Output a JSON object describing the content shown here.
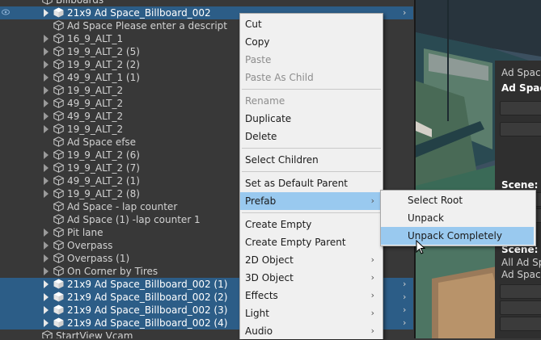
{
  "hierarchy": {
    "rows": [
      {
        "label": "Billboards",
        "kind": "folder",
        "depth": 0,
        "sel": false,
        "partial": true
      },
      {
        "label": "21x9 Ad Space_Billboard_002",
        "kind": "prefab",
        "depth": 1,
        "sel": true,
        "arrow": true,
        "chev": true
      },
      {
        "label": "Ad Space Please enter a descript",
        "kind": "obj",
        "depth": 1,
        "sel": false
      },
      {
        "label": "16_9_ALT_1",
        "kind": "obj",
        "depth": 1,
        "arrow": true
      },
      {
        "label": "19_9_ALT_2 (5)",
        "kind": "obj",
        "depth": 1,
        "arrow": true
      },
      {
        "label": "19_9_ALT_2 (2)",
        "kind": "obj",
        "depth": 1,
        "arrow": true
      },
      {
        "label": "49_9_ALT_1 (1)",
        "kind": "obj",
        "depth": 1,
        "arrow": true
      },
      {
        "label": "19_9_ALT_2",
        "kind": "obj",
        "depth": 1,
        "arrow": true
      },
      {
        "label": "49_9_ALT_2",
        "kind": "obj",
        "depth": 1,
        "arrow": true
      },
      {
        "label": "49_9_ALT_2",
        "kind": "obj",
        "depth": 1,
        "arrow": true
      },
      {
        "label": "19_9_ALT_2",
        "kind": "obj",
        "depth": 1,
        "arrow": true
      },
      {
        "label": "Ad Space efse",
        "kind": "obj",
        "depth": 1
      },
      {
        "label": "19_9_ALT_2 (6)",
        "kind": "obj",
        "depth": 1,
        "arrow": true
      },
      {
        "label": "19_9_ALT_2 (7)",
        "kind": "obj",
        "depth": 1,
        "arrow": true
      },
      {
        "label": "49_9_ALT_2 (1)",
        "kind": "obj",
        "depth": 1,
        "arrow": true
      },
      {
        "label": "19_9_ALT_2 (8)",
        "kind": "obj",
        "depth": 1,
        "arrow": true
      },
      {
        "label": "Ad Space - lap counter",
        "kind": "obj",
        "depth": 1
      },
      {
        "label": "Ad Space (1) -lap counter 1",
        "kind": "obj",
        "depth": 1
      },
      {
        "label": "Pit lane",
        "kind": "obj",
        "depth": 1,
        "arrow": true
      },
      {
        "label": "Overpass",
        "kind": "obj",
        "depth": 1,
        "arrow": true
      },
      {
        "label": "Overpass (1)",
        "kind": "obj",
        "depth": 1,
        "arrow": true
      },
      {
        "label": "On Corner by Tires",
        "kind": "obj",
        "depth": 1,
        "arrow": true
      },
      {
        "label": "21x9 Ad Space_Billboard_002 (1)",
        "kind": "prefab",
        "depth": 1,
        "sel": true,
        "arrow": true,
        "chev": true
      },
      {
        "label": "21x9 Ad Space_Billboard_002 (2)",
        "kind": "prefab",
        "depth": 1,
        "sel": true,
        "arrow": true,
        "chev": true
      },
      {
        "label": "21x9 Ad Space_Billboard_002 (3)",
        "kind": "prefab",
        "depth": 1,
        "sel": true,
        "arrow": true,
        "chev": true
      },
      {
        "label": "21x9 Ad Space_Billboard_002 (4)",
        "kind": "prefab",
        "depth": 1,
        "sel": true,
        "arrow": true,
        "chev": true
      },
      {
        "label": "StartView Vcam",
        "kind": "obj",
        "depth": 0,
        "partial": true
      }
    ]
  },
  "context_menu": {
    "items": [
      {
        "label": "Cut",
        "disabled": false
      },
      {
        "label": "Copy",
        "disabled": false
      },
      {
        "label": "Paste",
        "disabled": true
      },
      {
        "label": "Paste As Child",
        "disabled": true
      },
      {
        "sep": true
      },
      {
        "label": "Rename",
        "disabled": true
      },
      {
        "label": "Duplicate",
        "disabled": false
      },
      {
        "label": "Delete",
        "disabled": false
      },
      {
        "sep": true
      },
      {
        "label": "Select Children",
        "disabled": false
      },
      {
        "sep": true
      },
      {
        "label": "Set as Default Parent",
        "disabled": false
      },
      {
        "label": "Prefab",
        "disabled": false,
        "submenu": true,
        "highlighted": true
      },
      {
        "sep": true
      },
      {
        "label": "Create Empty",
        "disabled": false
      },
      {
        "label": "Create Empty Parent",
        "disabled": false
      },
      {
        "label": "2D Object",
        "disabled": false,
        "submenu": true
      },
      {
        "label": "3D Object",
        "disabled": false,
        "submenu": true
      },
      {
        "label": "Effects",
        "disabled": false,
        "submenu": true
      },
      {
        "label": "Light",
        "disabled": false,
        "submenu": true
      },
      {
        "label": "Audio",
        "disabled": false,
        "submenu": true
      }
    ]
  },
  "prefab_submenu": {
    "items": [
      {
        "label": "Select Root",
        "highlighted": false
      },
      {
        "label": "Unpack",
        "highlighted": false
      },
      {
        "label": "Unpack Completely",
        "highlighted": true
      }
    ]
  },
  "inspector": {
    "title1": "Ad Space",
    "title2": "Ad Spac",
    "scene_label_1": "Scene: A",
    "scene_label_2": "Scene: A",
    "list_1": "All Ad Sp",
    "list_2": "Ad Space",
    "scene_label_3": "Scene: A"
  },
  "glyphs": {
    "submenu_arrow": "›",
    "row_chevron": "›"
  },
  "colors": {
    "selection": "#2c5d87",
    "menu_bg": "#f0f0f0",
    "menu_highlight": "#99c9ef"
  }
}
